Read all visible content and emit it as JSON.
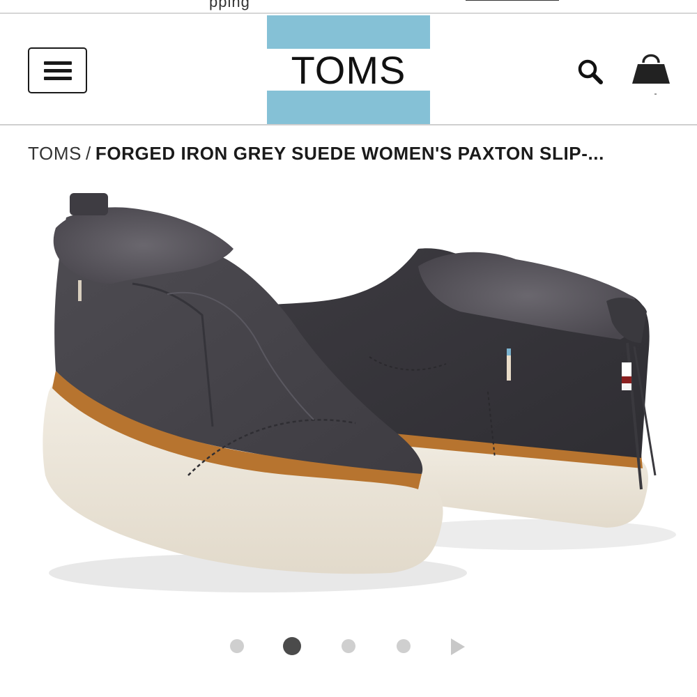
{
  "promo": {
    "text": "pping",
    "link_text": ""
  },
  "header": {
    "menu_icon": "hamburger-menu-icon",
    "logo_text": "TOMS",
    "logo_colors": {
      "band": "#85c1d6",
      "text": "#111111"
    },
    "search_icon": "search-icon",
    "cart_icon": "shopping-bag-icon"
  },
  "breadcrumb": {
    "home": "TOMS",
    "separator": "/",
    "current": "FORGED IRON GREY SUEDE WOMEN'S PAXTON SLIP-..."
  },
  "product": {
    "image_description_icon": "product-photo",
    "colors": {
      "suede": "#46444a",
      "fur": "#55525a",
      "welt": "#b7742f",
      "sole": "#ece6da"
    }
  },
  "carousel": {
    "total": 4,
    "active_index": 1,
    "next_icon": "play-arrow-icon",
    "colors": {
      "active": "#4b4b4b",
      "inactive": "#cfcfcf"
    }
  }
}
